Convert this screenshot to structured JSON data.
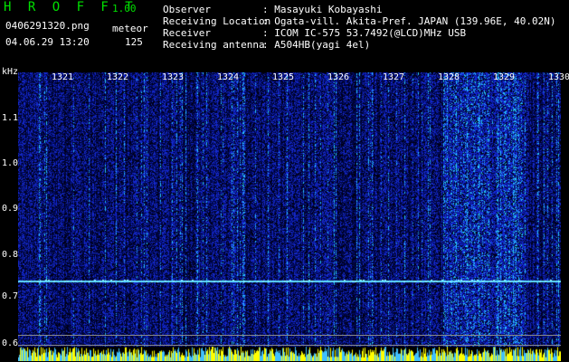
{
  "app": {
    "name": "H R O F F T",
    "version": "1.00"
  },
  "file": {
    "name": "0406291320.png",
    "datetime": "04.06.29 13:20"
  },
  "meteor": {
    "label": "meteor",
    "count": "125"
  },
  "station": {
    "observer": {
      "label": "Observer",
      "value": ": Masayuki Kobayashi"
    },
    "location": {
      "label": "Receiving Location",
      "value": ": Ogata-vill. Akita-Pref. JAPAN (139.96E, 40.02N)"
    },
    "receiver": {
      "label": "Receiver",
      "value": ": ICOM IC-575 53.7492(@LCD)MHz USB"
    },
    "antenna": {
      "label": "Receiving antenna",
      "value": ": A504HB(yagi 4el)"
    }
  },
  "spectrogram": {
    "y_unit": "kHz",
    "y_ticks": [
      "1.1",
      "1.0",
      "0.9",
      "0.8",
      "0.7",
      "0.6"
    ],
    "x_ticks": [
      "1321",
      "1322",
      "1323",
      "1324",
      "1325",
      "1326",
      "1327",
      "1328",
      "1329",
      "1330"
    ],
    "colors": {
      "background": "#000018",
      "signal": "#2040ff",
      "strong": "#40ffff",
      "carrier": "#60e0ff",
      "histogram": "#ffff00"
    }
  }
}
